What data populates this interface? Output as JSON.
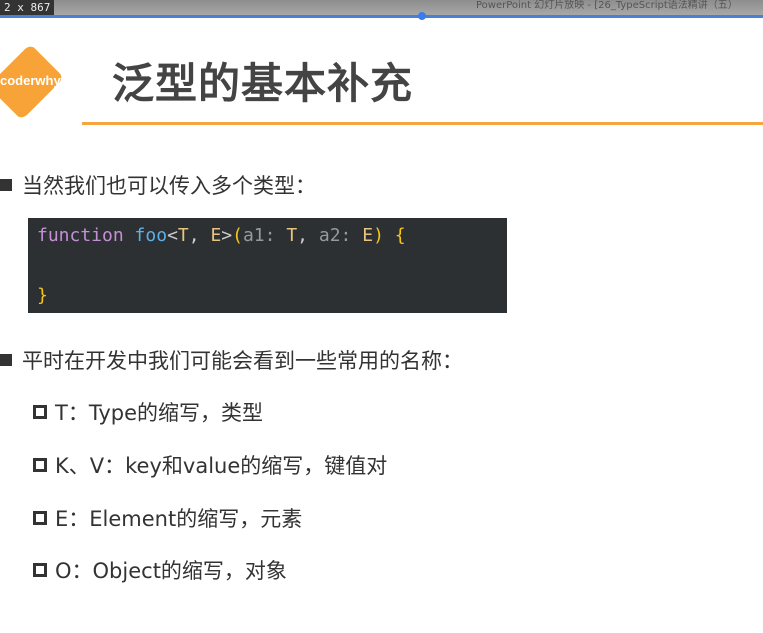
{
  "window": {
    "dimensions": "2 x 867",
    "title": "PowerPoint 幻灯片放映 - [26_TypeScript语法精讲（五）"
  },
  "logo": "coderwhy",
  "slide": {
    "title": "泛型的基本补充",
    "bullet1": "当然我们也可以传入多个类型：",
    "code": {
      "keyword": "function",
      "name": "foo",
      "lt": "<",
      "T": "T",
      "comma1": ", ",
      "E": "E",
      "gt": ">",
      "open_paren": "(",
      "a1": "a1: ",
      "T2": "T",
      "comma2": ", ",
      "a2": "a2: ",
      "E2": "E",
      "close_paren": ")",
      "open_brace": " {",
      "close_brace": "}"
    },
    "bullet2": "平时在开发中我们可能会看到一些常用的名称：",
    "items": [
      "T：Type的缩写，类型",
      "K、V：key和value的缩写，键值对",
      "E：Element的缩写，元素",
      "O：Object的缩写，对象"
    ]
  }
}
